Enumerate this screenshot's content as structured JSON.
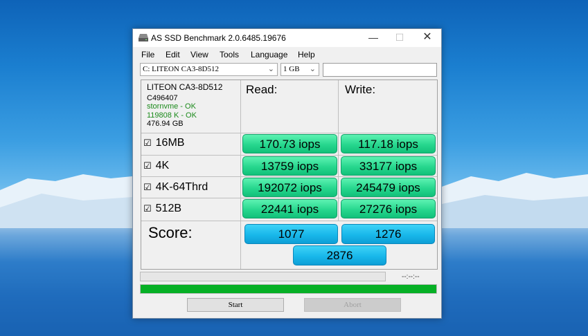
{
  "window": {
    "title": "AS SSD Benchmark 2.0.6485.19676"
  },
  "menu": [
    "File",
    "Edit",
    "View",
    "Tools",
    "Language",
    "Help"
  ],
  "drive_select": {
    "value": "C: LITEON CA3-8D512"
  },
  "size_select": {
    "value": "1 GB"
  },
  "search_text": {
    "value": ""
  },
  "drive_info": {
    "model": "LITEON CA3-8D512",
    "firmware": "C496407",
    "driver": "stornvme - OK",
    "alignment": "119808 K - OK",
    "capacity": "476.94 GB"
  },
  "headers": {
    "read": "Read:",
    "write": "Write:"
  },
  "tests": [
    {
      "label": "16MB",
      "checked": true,
      "read": "170.73 iops",
      "write": "117.18 iops"
    },
    {
      "label": "4K",
      "checked": true,
      "read": "13759 iops",
      "write": "33177 iops"
    },
    {
      "label": "4K-64Thrd",
      "checked": true,
      "read": "192072 iops",
      "write": "245479 iops"
    },
    {
      "label": "512B",
      "checked": true,
      "read": "22441 iops",
      "write": "27276 iops"
    }
  ],
  "score": {
    "label": "Score:",
    "read": "1077",
    "write": "1276",
    "total": "2876"
  },
  "progress": {
    "time": "--:--:--",
    "completion": 1.0
  },
  "buttons": {
    "start": "Start",
    "abort": "Abort"
  },
  "colors": {
    "result_green": "#27d78e",
    "score_blue": "#18b7ea",
    "progress_green": "#06b025",
    "ok_text": "#1b8a1b"
  }
}
